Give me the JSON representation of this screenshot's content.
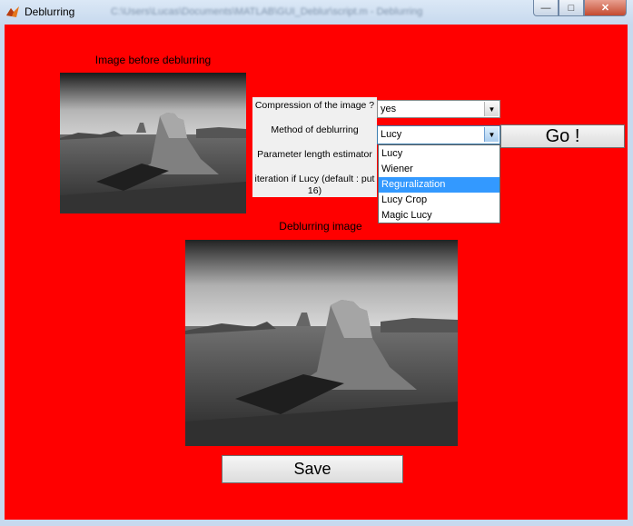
{
  "window": {
    "title": "Deblurring",
    "blurred_path": "C:\\Users\\Lucas\\Documents\\MATLAB\\GUI_Deblur\\script.m - Deblurring",
    "minimize_glyph": "—",
    "maximize_glyph": "□",
    "close_glyph": "✕"
  },
  "colors": {
    "background": "#ff0000",
    "highlight": "#3399ff"
  },
  "labels": {
    "before": "Image before deblurring",
    "after": "Deblurring image"
  },
  "panel": {
    "compression_label": "Compression of the image ?",
    "method_label": "Method of deblurring",
    "param_label": "Parameter length estimator",
    "iteration_label": "iteration if Lucy (default : put 16)"
  },
  "compression": {
    "value": "yes"
  },
  "method": {
    "value": "Lucy",
    "options": [
      "Lucy",
      "Wiener",
      "Reguralization",
      "Lucy Crop",
      "Magic Lucy"
    ],
    "highlighted": "Reguralization"
  },
  "buttons": {
    "go": "Go !",
    "save": "Save"
  },
  "icons": {
    "app": "matlab-icon",
    "dropdown": "chevron-down-icon"
  }
}
